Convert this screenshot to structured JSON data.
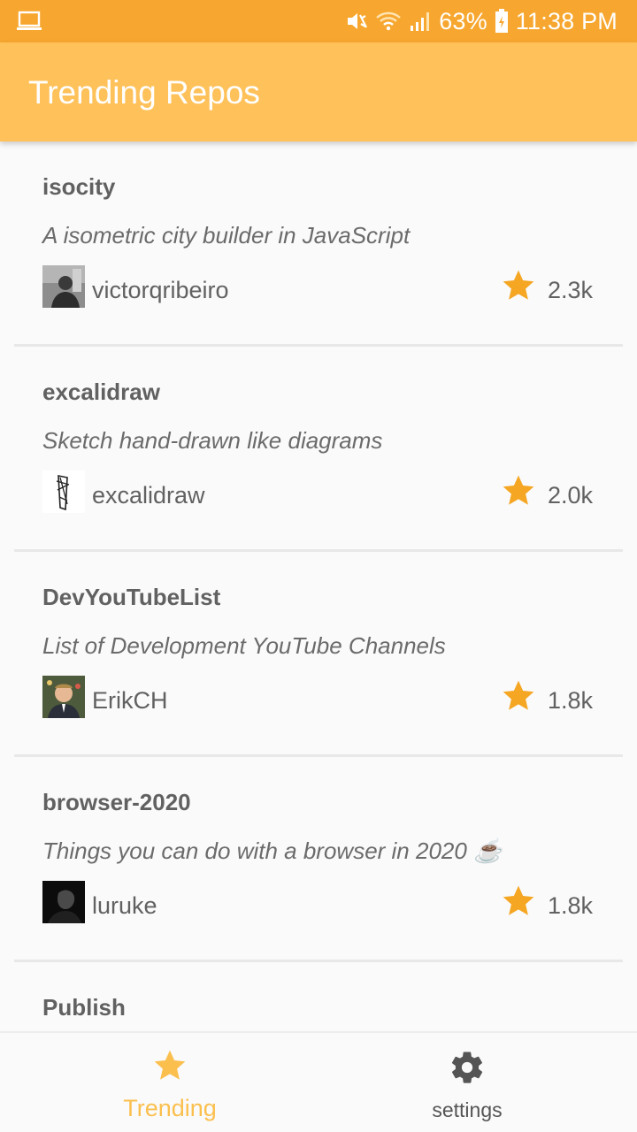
{
  "status_bar": {
    "battery": "63%",
    "time": "11:38 PM",
    "icons": [
      "laptop-icon",
      "mute-icon",
      "wifi-icon",
      "signal-icon",
      "battery-icon"
    ]
  },
  "app_bar": {
    "title": "Trending Repos"
  },
  "colors": {
    "status_bar": "#f7a72f",
    "app_bar": "#ffc15a",
    "accent": "#fbbf4e",
    "star": "#f5a623"
  },
  "repos": [
    {
      "name": "isocity",
      "description": "A isometric city builder in JavaScript",
      "owner": "victorqribeiro",
      "stars": "2.3k"
    },
    {
      "name": "excalidraw",
      "description": "Sketch hand-drawn like diagrams",
      "owner": "excalidraw",
      "stars": "2.0k"
    },
    {
      "name": "DevYouTubeList",
      "description": "List of Development YouTube Channels",
      "owner": "ErikCH",
      "stars": "1.8k"
    },
    {
      "name": "browser-2020",
      "description": "Things you can do with a browser in 2020 ☕️",
      "owner": "luruke",
      "stars": "1.8k"
    },
    {
      "name": "Publish",
      "description": "",
      "owner": "",
      "stars": ""
    }
  ],
  "bottom_nav": {
    "trending_label": "Trending",
    "settings_label": "settings"
  }
}
